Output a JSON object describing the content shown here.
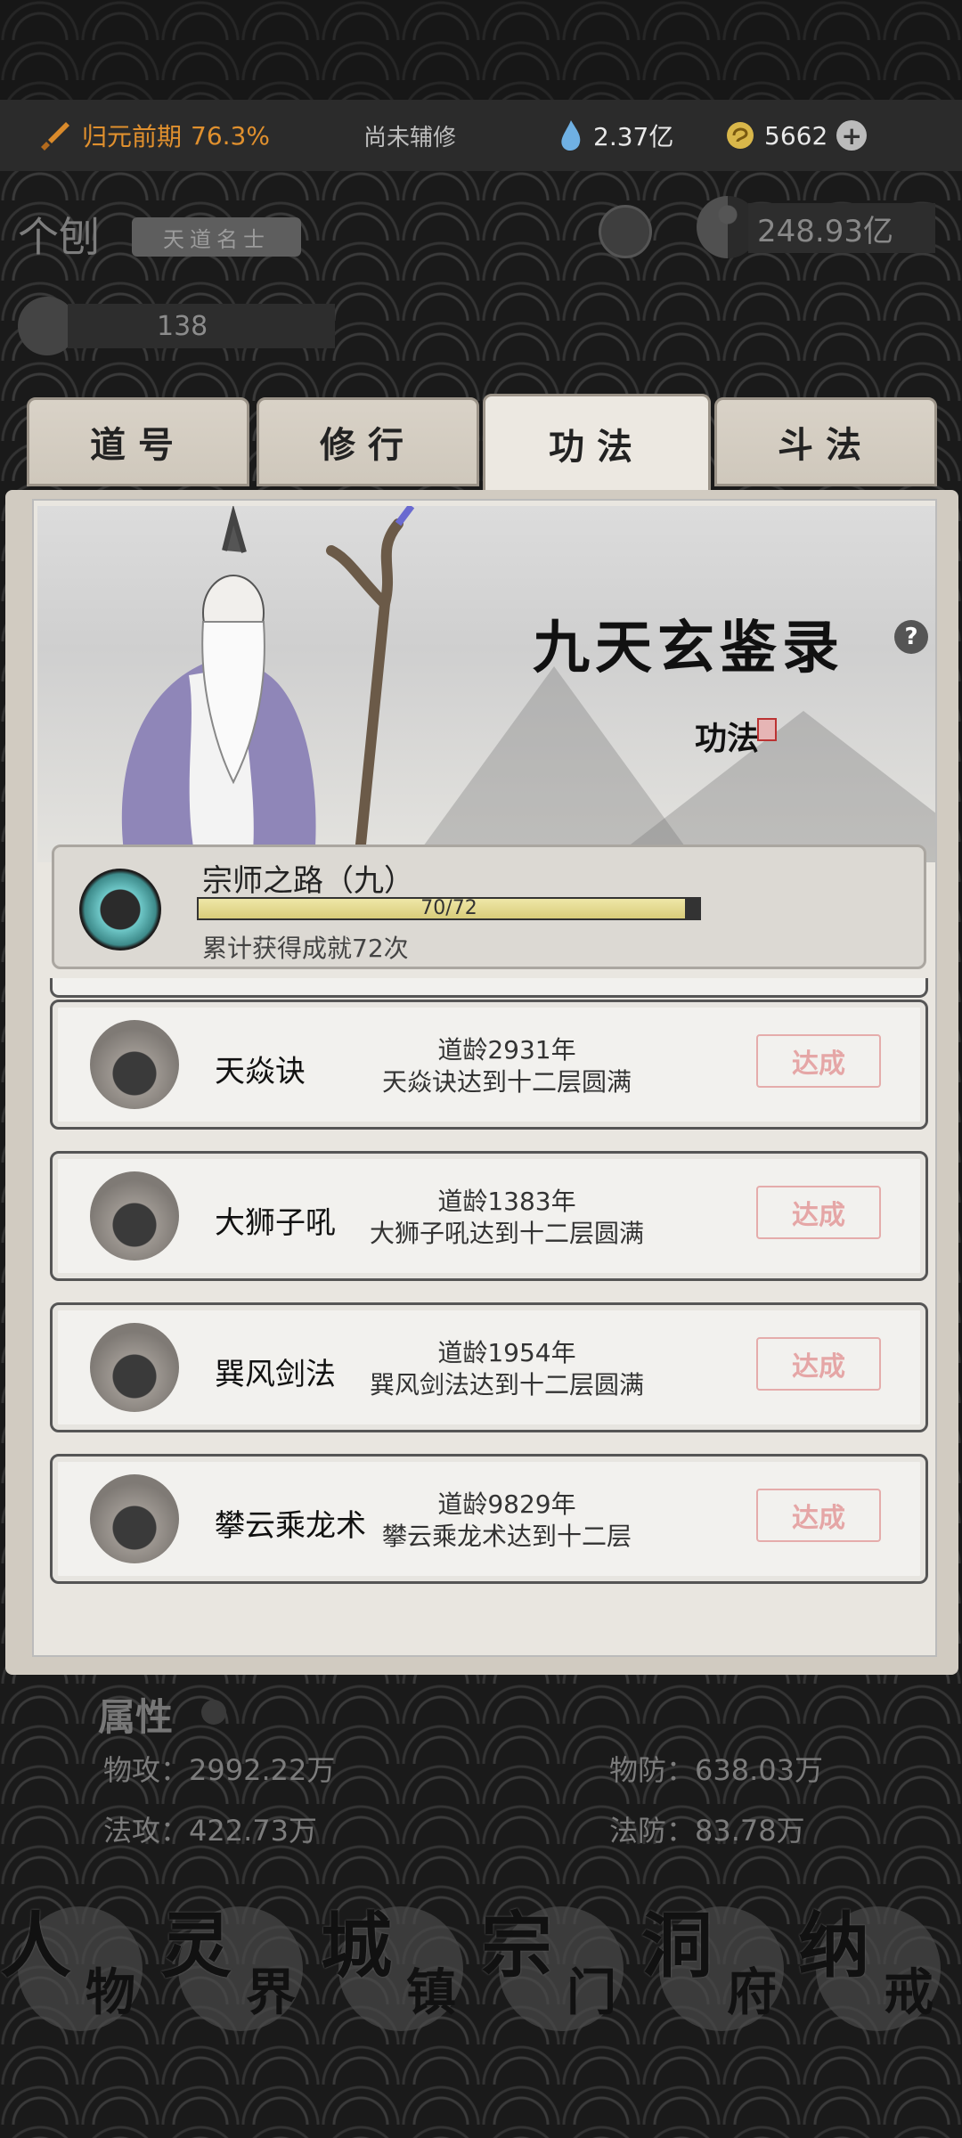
{
  "status": {
    "realm_label": "归元前期",
    "realm_progress": "76.3%",
    "assist_text": "尚未辅修",
    "spirit_stones": "2.37亿",
    "coins": "5662",
    "plus_symbol": "+"
  },
  "character": {
    "name": "个刨",
    "title": "天道名士",
    "power": "248.93亿",
    "secondary_value": "138"
  },
  "tabs": [
    {
      "label": "道号",
      "active": false
    },
    {
      "label": "修行",
      "active": false
    },
    {
      "label": "功法",
      "active": true
    },
    {
      "label": "斗法",
      "active": false
    }
  ],
  "banner": {
    "book_title": "九天玄鉴录",
    "help_symbol": "?",
    "subtitle": "功法"
  },
  "achievement": {
    "name": "宗师之路（九）",
    "progress_text": "70/72",
    "progress_fraction": 0.972,
    "description": "累计获得成就72次"
  },
  "achievements": [
    {
      "name": "天焱诀",
      "age": "道龄2931年",
      "condition": "天焱诀达到十二层圆满",
      "status": "达成"
    },
    {
      "name": "大狮子吼",
      "age": "道龄1383年",
      "condition": "大狮子吼达到十二层圆满",
      "status": "达成"
    },
    {
      "name": "巽风剑法",
      "age": "道龄1954年",
      "condition": "巽风剑法达到十二层圆满",
      "status": "达成"
    },
    {
      "name": "攀云乘龙术",
      "age": "道龄9829年",
      "condition": "攀云乘龙术达到十二层",
      "status": "达成"
    }
  ],
  "attributes": {
    "title": "属性",
    "phys_atk": "物攻：2992.22万",
    "phys_def": "物防：638.03万",
    "mag_atk": "法攻：422.73万",
    "mag_def": "法防：83.78万"
  },
  "nav": [
    {
      "big": "人",
      "small": "物"
    },
    {
      "big": "灵",
      "small": "界"
    },
    {
      "big": "城",
      "small": "镇"
    },
    {
      "big": "宗",
      "small": "门"
    },
    {
      "big": "洞",
      "small": "府"
    },
    {
      "big": "纳",
      "small": "戒"
    }
  ],
  "colors": {
    "accent": "#e0902e",
    "done_stamp": "#e39a9a",
    "panel": "#e9e6e0"
  }
}
